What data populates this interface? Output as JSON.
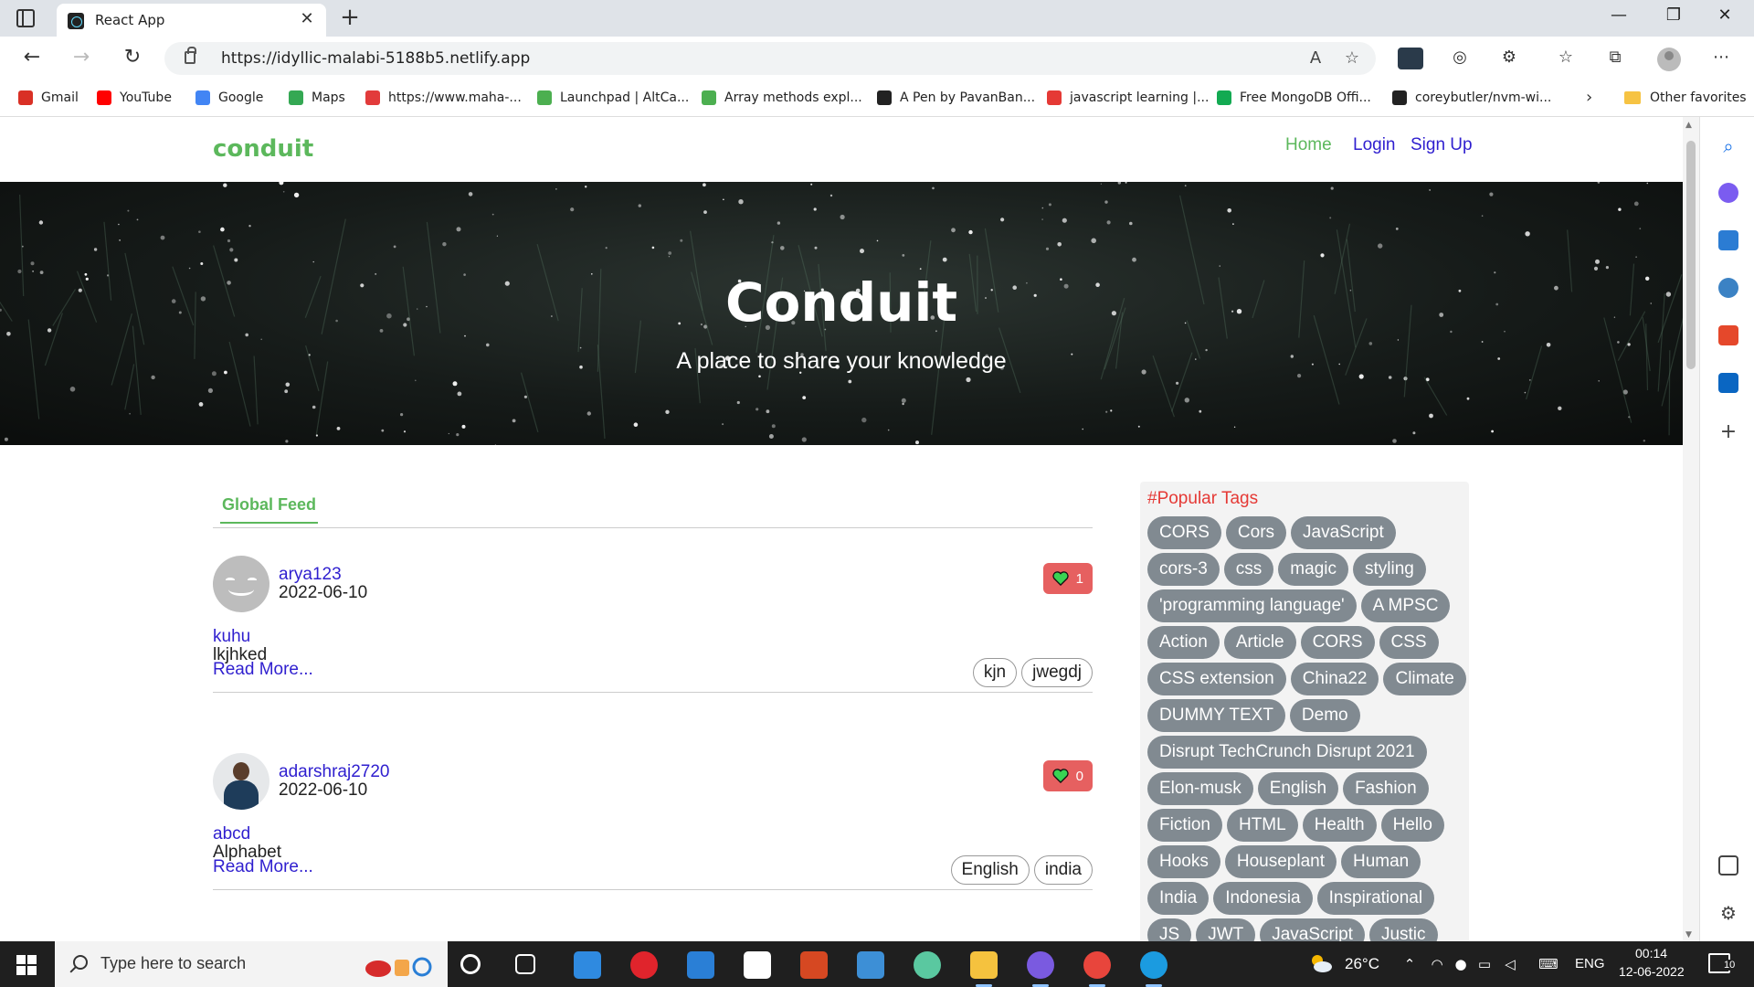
{
  "browser": {
    "tab_title": "React App",
    "url": "https://idyllic-malabi-5188b5.netlify.app",
    "bookmarks": [
      {
        "label": "Gmail",
        "color": "#d93025"
      },
      {
        "label": "YouTube",
        "color": "#ff0000"
      },
      {
        "label": "Google",
        "color": "#4285f4"
      },
      {
        "label": "Maps",
        "color": "#34a853"
      },
      {
        "label": "https://www.maha-...",
        "color": "#e23b3b"
      },
      {
        "label": "Launchpad | AltCa...",
        "color": "#4caf50"
      },
      {
        "label": "Array methods expl...",
        "color": "#4caf50"
      },
      {
        "label": "A Pen by PavanBan...",
        "color": "#222222"
      },
      {
        "label": "javascript learning |...",
        "color": "#e53935"
      },
      {
        "label": "Free MongoDB Offi...",
        "color": "#13aa52"
      },
      {
        "label": "coreybutler/nvm-wi...",
        "color": "#222222"
      }
    ],
    "other_favorites": "Other favorites"
  },
  "app": {
    "brand": "conduit",
    "nav": {
      "home": "Home",
      "login": "Login",
      "signup": "Sign Up"
    },
    "banner": {
      "title": "Conduit",
      "subtitle": "A place to share your knowledge"
    },
    "feed_tab": "Global Feed",
    "read_more": "Read More...",
    "articles": [
      {
        "author": "arya123",
        "date": "2022-06-10",
        "likes": "1",
        "title": "kuhu",
        "description": "lkjhked",
        "tags": [
          "kjn",
          "jwegdj"
        ]
      },
      {
        "author": "adarshraj2720",
        "date": "2022-06-10",
        "likes": "0",
        "title": "abcd",
        "description": "Alphabet",
        "tags": [
          "English",
          "india"
        ]
      }
    ],
    "popular_tags_title": "#Popular Tags",
    "popular_tags": [
      "CORS",
      "Cors",
      "JavaScript",
      "cors-3",
      "css",
      "magic",
      "styling",
      "'programming language'",
      "A MPSC",
      "Action",
      "Article",
      "CORS",
      "CSS",
      "CSS extension",
      "China22",
      "Climate",
      "DUMMY TEXT",
      "Demo",
      "Disrupt TechCrunch Disrupt 2021",
      "Elon-musk",
      "English",
      "Fashion",
      "Fiction",
      "HTML",
      "Health",
      "Hello",
      "Hooks",
      "Houseplant",
      "Human",
      "India",
      "Indonesia",
      "Inspirational",
      "JS",
      "JWT",
      "JavaScript",
      "Justic"
    ]
  },
  "taskbar": {
    "search_placeholder": "Type here to search",
    "temperature": "26°C",
    "language": "ENG",
    "time": "00:14",
    "date": "12-06-2022",
    "notifications": "10"
  },
  "colors": {
    "brand_green": "#5cb85c",
    "link_blue": "#2f1fcf",
    "like_red": "#e66060",
    "tag_gray": "#818a91",
    "popular_red": "#e53935"
  }
}
